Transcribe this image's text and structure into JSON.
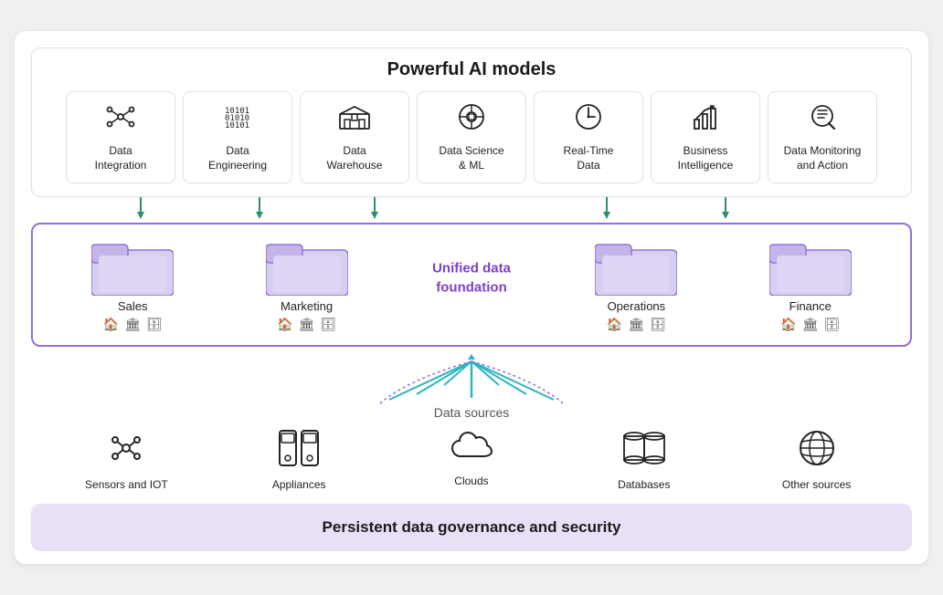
{
  "header": {
    "title": "Powerful AI models"
  },
  "aiCards": [
    {
      "id": "data-integration",
      "label": "Data\nIntegration",
      "iconType": "integration"
    },
    {
      "id": "data-engineering",
      "label": "Data\nEngineering",
      "iconType": "engineering"
    },
    {
      "id": "data-warehouse",
      "label": "Data\nWarehouse",
      "iconType": "warehouse"
    },
    {
      "id": "data-science",
      "label": "Data Science\n& ML",
      "iconType": "science"
    },
    {
      "id": "realtime-data",
      "label": "Real-Time\nData",
      "iconType": "realtime"
    },
    {
      "id": "business-intelligence",
      "label": "Business\nIntelligence",
      "iconType": "bi"
    },
    {
      "id": "data-monitoring",
      "label": "Data Monitoring\nand Action",
      "iconType": "monitoring"
    }
  ],
  "unifiedFoundation": {
    "title": "Unified data\nfoundation",
    "domains": [
      {
        "id": "sales",
        "label": "Sales"
      },
      {
        "id": "marketing",
        "label": "Marketing"
      },
      {
        "id": "operations",
        "label": "Operations"
      },
      {
        "id": "finance",
        "label": "Finance"
      }
    ]
  },
  "dataSources": {
    "sectionLabel": "Data sources",
    "items": [
      {
        "id": "sensors-iot",
        "label": "Sensors and IOT",
        "iconType": "sensors"
      },
      {
        "id": "appliances",
        "label": "Appliances",
        "iconType": "appliances"
      },
      {
        "id": "clouds",
        "label": "Clouds",
        "iconType": "clouds"
      },
      {
        "id": "databases",
        "label": "Databases",
        "iconType": "databases"
      },
      {
        "id": "other-sources",
        "label": "Other sources",
        "iconType": "other"
      }
    ]
  },
  "governance": {
    "title": "Persistent data governance and security"
  }
}
